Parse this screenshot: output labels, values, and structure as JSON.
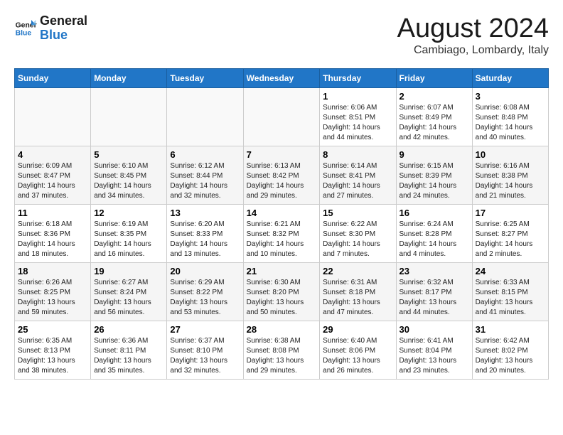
{
  "logo": {
    "line1": "General",
    "line2": "Blue"
  },
  "title": "August 2024",
  "location": "Cambiago, Lombardy, Italy",
  "days_of_week": [
    "Sunday",
    "Monday",
    "Tuesday",
    "Wednesday",
    "Thursday",
    "Friday",
    "Saturday"
  ],
  "weeks": [
    [
      {
        "day": "",
        "info": ""
      },
      {
        "day": "",
        "info": ""
      },
      {
        "day": "",
        "info": ""
      },
      {
        "day": "",
        "info": ""
      },
      {
        "day": "1",
        "info": "Sunrise: 6:06 AM\nSunset: 8:51 PM\nDaylight: 14 hours and 44 minutes."
      },
      {
        "day": "2",
        "info": "Sunrise: 6:07 AM\nSunset: 8:49 PM\nDaylight: 14 hours and 42 minutes."
      },
      {
        "day": "3",
        "info": "Sunrise: 6:08 AM\nSunset: 8:48 PM\nDaylight: 14 hours and 40 minutes."
      }
    ],
    [
      {
        "day": "4",
        "info": "Sunrise: 6:09 AM\nSunset: 8:47 PM\nDaylight: 14 hours and 37 minutes."
      },
      {
        "day": "5",
        "info": "Sunrise: 6:10 AM\nSunset: 8:45 PM\nDaylight: 14 hours and 34 minutes."
      },
      {
        "day": "6",
        "info": "Sunrise: 6:12 AM\nSunset: 8:44 PM\nDaylight: 14 hours and 32 minutes."
      },
      {
        "day": "7",
        "info": "Sunrise: 6:13 AM\nSunset: 8:42 PM\nDaylight: 14 hours and 29 minutes."
      },
      {
        "day": "8",
        "info": "Sunrise: 6:14 AM\nSunset: 8:41 PM\nDaylight: 14 hours and 27 minutes."
      },
      {
        "day": "9",
        "info": "Sunrise: 6:15 AM\nSunset: 8:39 PM\nDaylight: 14 hours and 24 minutes."
      },
      {
        "day": "10",
        "info": "Sunrise: 6:16 AM\nSunset: 8:38 PM\nDaylight: 14 hours and 21 minutes."
      }
    ],
    [
      {
        "day": "11",
        "info": "Sunrise: 6:18 AM\nSunset: 8:36 PM\nDaylight: 14 hours and 18 minutes."
      },
      {
        "day": "12",
        "info": "Sunrise: 6:19 AM\nSunset: 8:35 PM\nDaylight: 14 hours and 16 minutes."
      },
      {
        "day": "13",
        "info": "Sunrise: 6:20 AM\nSunset: 8:33 PM\nDaylight: 14 hours and 13 minutes."
      },
      {
        "day": "14",
        "info": "Sunrise: 6:21 AM\nSunset: 8:32 PM\nDaylight: 14 hours and 10 minutes."
      },
      {
        "day": "15",
        "info": "Sunrise: 6:22 AM\nSunset: 8:30 PM\nDaylight: 14 hours and 7 minutes."
      },
      {
        "day": "16",
        "info": "Sunrise: 6:24 AM\nSunset: 8:28 PM\nDaylight: 14 hours and 4 minutes."
      },
      {
        "day": "17",
        "info": "Sunrise: 6:25 AM\nSunset: 8:27 PM\nDaylight: 14 hours and 2 minutes."
      }
    ],
    [
      {
        "day": "18",
        "info": "Sunrise: 6:26 AM\nSunset: 8:25 PM\nDaylight: 13 hours and 59 minutes."
      },
      {
        "day": "19",
        "info": "Sunrise: 6:27 AM\nSunset: 8:24 PM\nDaylight: 13 hours and 56 minutes."
      },
      {
        "day": "20",
        "info": "Sunrise: 6:29 AM\nSunset: 8:22 PM\nDaylight: 13 hours and 53 minutes."
      },
      {
        "day": "21",
        "info": "Sunrise: 6:30 AM\nSunset: 8:20 PM\nDaylight: 13 hours and 50 minutes."
      },
      {
        "day": "22",
        "info": "Sunrise: 6:31 AM\nSunset: 8:18 PM\nDaylight: 13 hours and 47 minutes."
      },
      {
        "day": "23",
        "info": "Sunrise: 6:32 AM\nSunset: 8:17 PM\nDaylight: 13 hours and 44 minutes."
      },
      {
        "day": "24",
        "info": "Sunrise: 6:33 AM\nSunset: 8:15 PM\nDaylight: 13 hours and 41 minutes."
      }
    ],
    [
      {
        "day": "25",
        "info": "Sunrise: 6:35 AM\nSunset: 8:13 PM\nDaylight: 13 hours and 38 minutes."
      },
      {
        "day": "26",
        "info": "Sunrise: 6:36 AM\nSunset: 8:11 PM\nDaylight: 13 hours and 35 minutes."
      },
      {
        "day": "27",
        "info": "Sunrise: 6:37 AM\nSunset: 8:10 PM\nDaylight: 13 hours and 32 minutes."
      },
      {
        "day": "28",
        "info": "Sunrise: 6:38 AM\nSunset: 8:08 PM\nDaylight: 13 hours and 29 minutes."
      },
      {
        "day": "29",
        "info": "Sunrise: 6:40 AM\nSunset: 8:06 PM\nDaylight: 13 hours and 26 minutes."
      },
      {
        "day": "30",
        "info": "Sunrise: 6:41 AM\nSunset: 8:04 PM\nDaylight: 13 hours and 23 minutes."
      },
      {
        "day": "31",
        "info": "Sunrise: 6:42 AM\nSunset: 8:02 PM\nDaylight: 13 hours and 20 minutes."
      }
    ]
  ]
}
